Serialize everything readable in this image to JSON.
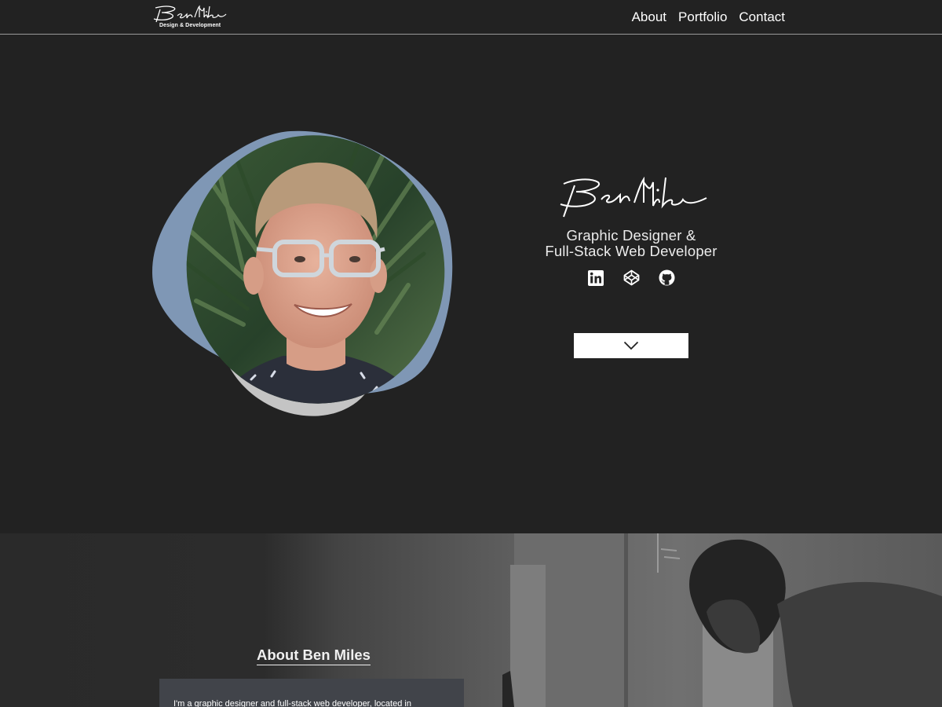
{
  "brand": {
    "name": "Ben Miles",
    "tagline": "Design & Development"
  },
  "nav": {
    "items": [
      {
        "label": "About"
      },
      {
        "label": "Portfolio"
      },
      {
        "label": "Contact"
      }
    ]
  },
  "hero": {
    "signature": "Ben Miles",
    "role_line1": "Graphic Designer &",
    "role_line2": "Full-Stack Web Developer",
    "socials": [
      {
        "icon": "linkedin-icon"
      },
      {
        "icon": "codepen-icon"
      },
      {
        "icon": "github-icon"
      }
    ],
    "scroll_icon": "chevron-down-icon"
  },
  "about": {
    "title": "About Ben Miles",
    "text": "I'm a graphic designer and full-stack web developer, located in"
  },
  "colors": {
    "background": "#222222",
    "blob_blue": "#7f97b5",
    "blob_gray": "#c4c4c4",
    "card": "#41444a",
    "button": "#ffffff"
  }
}
